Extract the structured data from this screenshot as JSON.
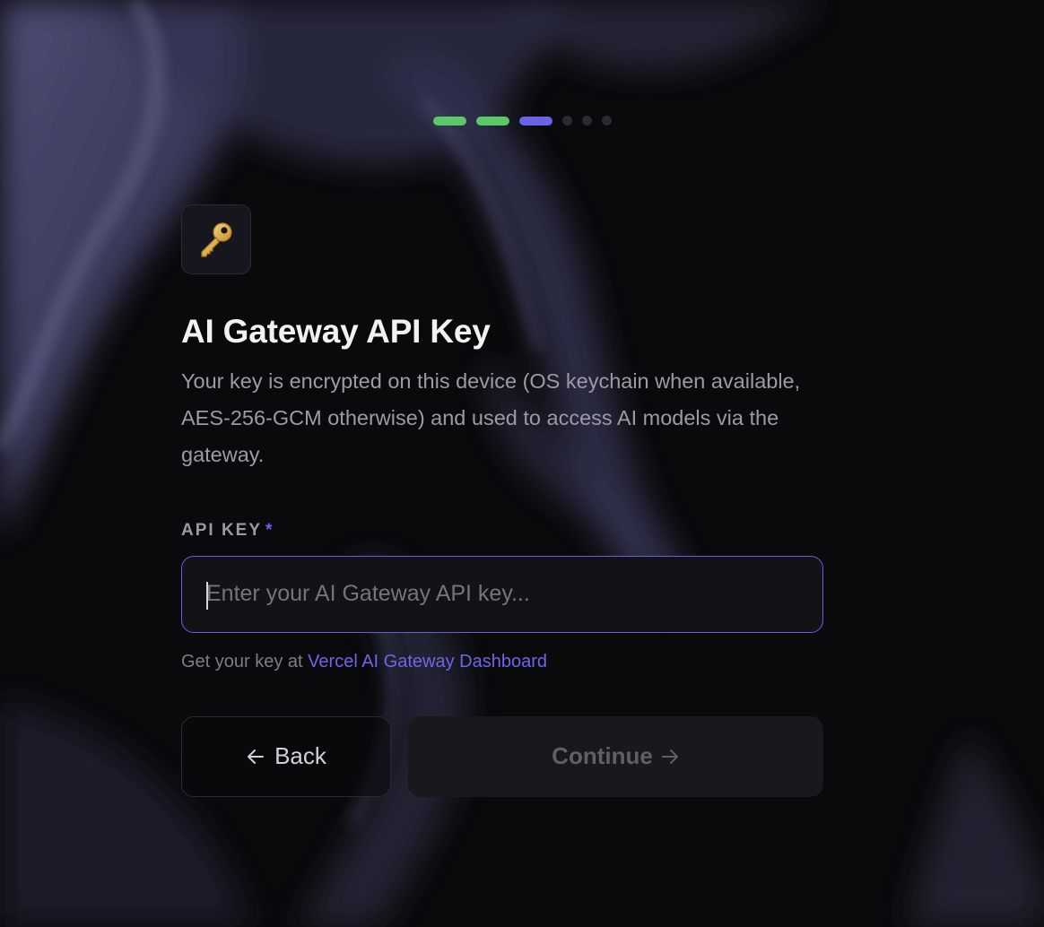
{
  "stepper": {
    "total": 6,
    "completed": 2,
    "current": 3,
    "colors": {
      "done": "#5cc86a",
      "active": "#6a63e6",
      "pending": "#2a2a30"
    }
  },
  "header": {
    "icon": "key-icon",
    "title": "AI Gateway API Key",
    "description": "Your key is encrypted on this device (OS keychain when available, AES-256-GCM otherwise) and used to access AI models via the gateway."
  },
  "form": {
    "api_key": {
      "label": "API KEY",
      "required_mark": "*",
      "placeholder": "Enter your AI Gateway API key...",
      "value": ""
    },
    "hint": {
      "prefix": "Get your key at ",
      "link_text": "Vercel AI Gateway Dashboard"
    }
  },
  "actions": {
    "back_label": "Back",
    "back_icon": "arrow-left-icon",
    "continue_label": "Continue",
    "continue_icon": "arrow-right-icon"
  },
  "theme": {
    "accent": "#6660e0",
    "background": "#0a0a0c"
  }
}
